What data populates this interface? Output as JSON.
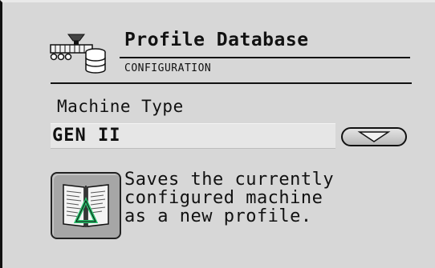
{
  "header": {
    "title": "Profile Database",
    "subtitle": "CONFIGURATION",
    "icon": "database-machine-icon"
  },
  "machine_type": {
    "label": "Machine Type",
    "selected_value": "GEN II",
    "dropdown_icon": "chevron-down-icon"
  },
  "save_profile": {
    "icon": "profile-book-icon",
    "description_lines": [
      "Saves the currently",
      "configured machine",
      "as a new profile."
    ]
  },
  "colors": {
    "background": "#d7d7d7",
    "text": "#111111",
    "accent": "#27c06a"
  }
}
